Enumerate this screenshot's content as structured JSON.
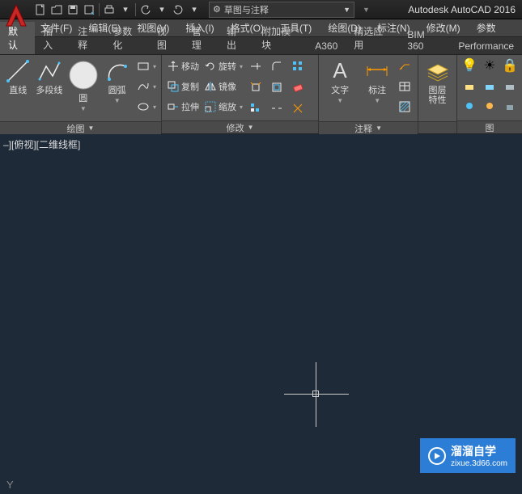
{
  "app": {
    "title": "Autodesk AutoCAD 2016",
    "workspace": "草图与注释"
  },
  "menubar": [
    "文件(F)",
    "编辑(E)",
    "视图(V)",
    "插入(I)",
    "格式(O)",
    "工具(T)",
    "绘图(D)",
    "标注(N)",
    "修改(M)",
    "参数"
  ],
  "tabs": [
    "默认",
    "插入",
    "注释",
    "参数化",
    "视图",
    "管理",
    "输出",
    "附加模块",
    "A360",
    "精选应用",
    "BIM 360",
    "Performance"
  ],
  "active_tab": "默认",
  "panels": {
    "draw": {
      "title": "绘图",
      "line": "直线",
      "polyline": "多段线",
      "circle": "圆",
      "arc": "圆弧"
    },
    "modify": {
      "title": "修改",
      "move": "移动",
      "copy": "复制",
      "stretch": "拉伸",
      "rotate": "旋转",
      "mirror": "镜像",
      "scale": "缩放"
    },
    "annotate": {
      "title": "注释",
      "text": "文字",
      "dim": "标注"
    },
    "layers": {
      "title": "图层",
      "props": "图层\n特性"
    },
    "extra": {
      "title": "图"
    }
  },
  "canvas": {
    "view_label": "–][俯视][二维线框]",
    "ucs_y": "Y"
  },
  "watermark": {
    "brand": "溜溜自学",
    "url": "zixue.3d66.com"
  }
}
